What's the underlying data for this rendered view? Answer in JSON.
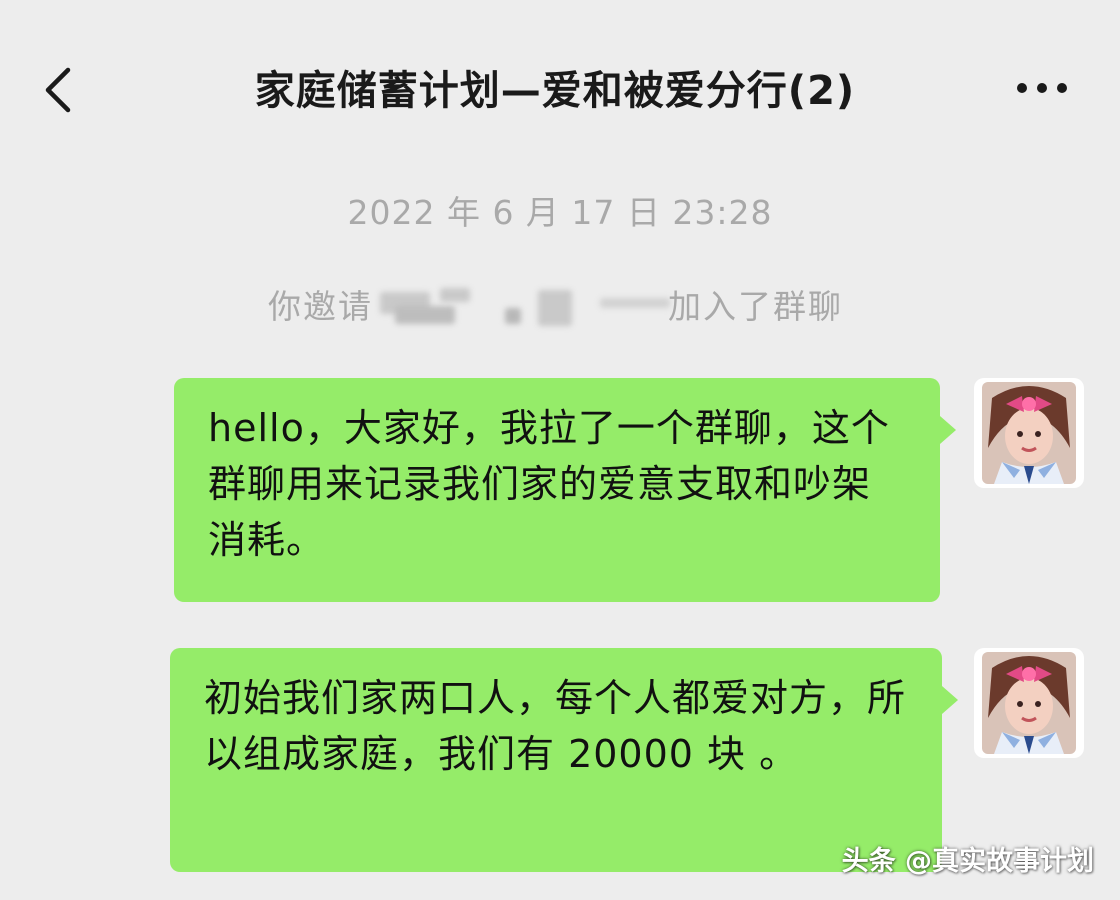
{
  "header": {
    "title": "家庭储蓄计划—爱和被爱分行(2)",
    "back_icon": "chevron-left-icon",
    "more_icon": "more-dots-icon"
  },
  "chat": {
    "timestamp": "2022 年 6 月 17 日 23:28",
    "system_notice_prefix": "你邀请",
    "system_notice_suffix": "加入了群聊",
    "messages": [
      {
        "sender": "self",
        "text": "hello，大家好，我拉了一个群聊，这个群聊用来记录我们家的爱意支取和吵架消耗。"
      },
      {
        "sender": "self",
        "text": "初始我们家两口人，每个人都爱对方，所以组成家庭，我们有 20000 块 。"
      }
    ]
  },
  "watermark": {
    "text": "头条 @真实故事计划"
  },
  "colors": {
    "background": "#ededed",
    "bubble_self": "#95ec69",
    "system_text": "#a9a9a9",
    "title_text": "#1a1a1a"
  }
}
